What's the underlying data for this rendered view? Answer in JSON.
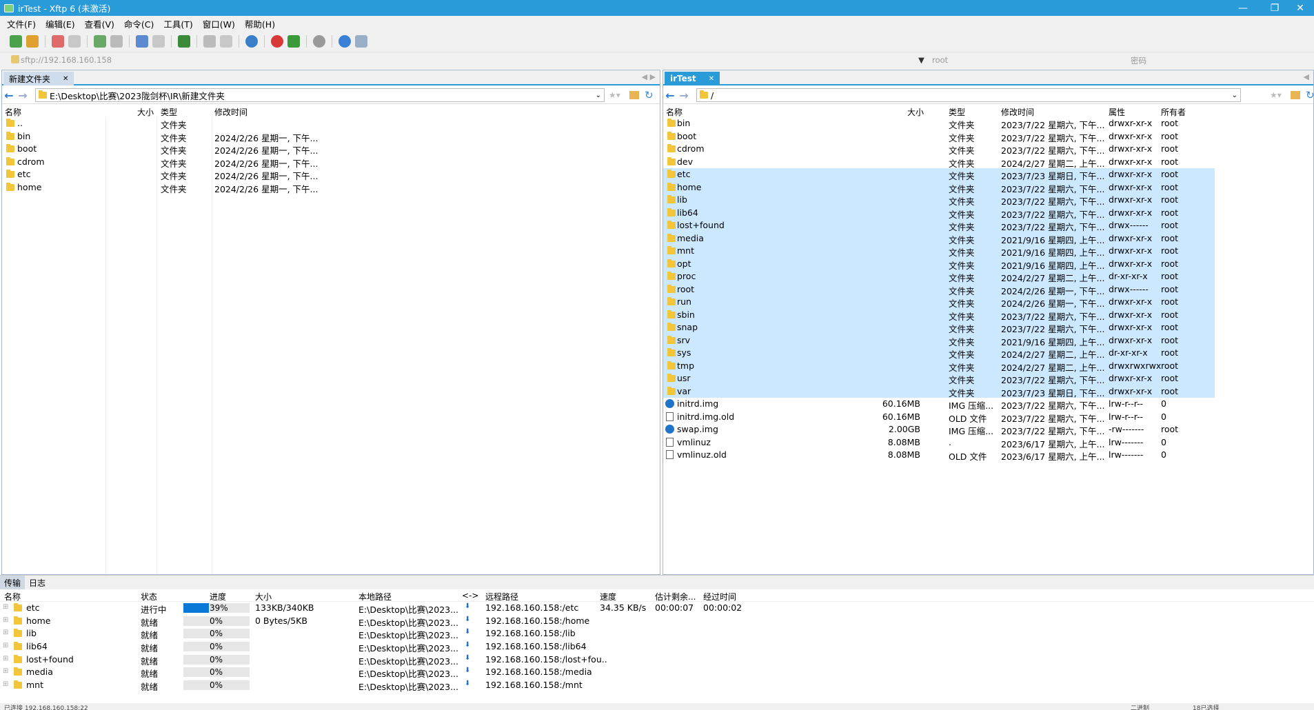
{
  "window": {
    "title": "irTest - Xftp 6 (未激活)"
  },
  "menu": [
    "文件(F)",
    "编辑(E)",
    "查看(V)",
    "命令(C)",
    "工具(T)",
    "窗口(W)",
    "帮助(H)"
  ],
  "address": {
    "url": "sftp://192.168.160.158",
    "user_placeholder": "root",
    "password_placeholder": "密码"
  },
  "left": {
    "tab": "新建文件夹",
    "path": "E:\\Desktop\\比赛\\2023陇剑杯\\IR\\新建文件夹",
    "headers": {
      "name": "名称",
      "size": "大小",
      "type": "类型",
      "mtime": "修改时间"
    },
    "files": [
      {
        "name": "..",
        "type": "文件夹",
        "mtime": ""
      },
      {
        "name": "bin",
        "type": "文件夹",
        "mtime": "2024/2/26 星期一, 下午..."
      },
      {
        "name": "boot",
        "type": "文件夹",
        "mtime": "2024/2/26 星期一, 下午..."
      },
      {
        "name": "cdrom",
        "type": "文件夹",
        "mtime": "2024/2/26 星期一, 下午..."
      },
      {
        "name": "etc",
        "type": "文件夹",
        "mtime": "2024/2/26 星期一, 下午..."
      },
      {
        "name": "home",
        "type": "文件夹",
        "mtime": "2024/2/26 星期一, 下午..."
      }
    ]
  },
  "right": {
    "tab": "irTest",
    "path": "/",
    "headers": {
      "name": "名称",
      "size": "大小",
      "type": "类型",
      "mtime": "修改时间",
      "attr": "属性",
      "owner": "所有者"
    },
    "files": [
      {
        "name": "bin",
        "size": "",
        "type": "文件夹",
        "mtime": "2023/7/22 星期六, 下午...",
        "attr": "drwxr-xr-x",
        "owner": "root",
        "sel": false,
        "icon": "folder"
      },
      {
        "name": "boot",
        "size": "",
        "type": "文件夹",
        "mtime": "2023/7/22 星期六, 下午...",
        "attr": "drwxr-xr-x",
        "owner": "root",
        "sel": false,
        "icon": "folder"
      },
      {
        "name": "cdrom",
        "size": "",
        "type": "文件夹",
        "mtime": "2023/7/22 星期六, 下午...",
        "attr": "drwxr-xr-x",
        "owner": "root",
        "sel": false,
        "icon": "folder"
      },
      {
        "name": "dev",
        "size": "",
        "type": "文件夹",
        "mtime": "2024/2/27 星期二, 上午...",
        "attr": "drwxr-xr-x",
        "owner": "root",
        "sel": false,
        "icon": "folder"
      },
      {
        "name": "etc",
        "size": "",
        "type": "文件夹",
        "mtime": "2023/7/23 星期日, 下午...",
        "attr": "drwxr-xr-x",
        "owner": "root",
        "sel": true,
        "icon": "folder"
      },
      {
        "name": "home",
        "size": "",
        "type": "文件夹",
        "mtime": "2023/7/22 星期六, 下午...",
        "attr": "drwxr-xr-x",
        "owner": "root",
        "sel": true,
        "icon": "folder"
      },
      {
        "name": "lib",
        "size": "",
        "type": "文件夹",
        "mtime": "2023/7/22 星期六, 下午...",
        "attr": "drwxr-xr-x",
        "owner": "root",
        "sel": true,
        "icon": "folder"
      },
      {
        "name": "lib64",
        "size": "",
        "type": "文件夹",
        "mtime": "2023/7/22 星期六, 下午...",
        "attr": "drwxr-xr-x",
        "owner": "root",
        "sel": true,
        "icon": "folder"
      },
      {
        "name": "lost+found",
        "size": "",
        "type": "文件夹",
        "mtime": "2023/7/22 星期六, 下午...",
        "attr": "drwx------",
        "owner": "root",
        "sel": true,
        "icon": "folder"
      },
      {
        "name": "media",
        "size": "",
        "type": "文件夹",
        "mtime": "2021/9/16 星期四, 上午...",
        "attr": "drwxr-xr-x",
        "owner": "root",
        "sel": true,
        "icon": "folder"
      },
      {
        "name": "mnt",
        "size": "",
        "type": "文件夹",
        "mtime": "2021/9/16 星期四, 上午...",
        "attr": "drwxr-xr-x",
        "owner": "root",
        "sel": true,
        "icon": "folder"
      },
      {
        "name": "opt",
        "size": "",
        "type": "文件夹",
        "mtime": "2021/9/16 星期四, 上午...",
        "attr": "drwxr-xr-x",
        "owner": "root",
        "sel": true,
        "icon": "folder"
      },
      {
        "name": "proc",
        "size": "",
        "type": "文件夹",
        "mtime": "2024/2/27 星期二, 上午...",
        "attr": "dr-xr-xr-x",
        "owner": "root",
        "sel": true,
        "icon": "folder"
      },
      {
        "name": "root",
        "size": "",
        "type": "文件夹",
        "mtime": "2024/2/26 星期一, 下午...",
        "attr": "drwx------",
        "owner": "root",
        "sel": true,
        "icon": "folder"
      },
      {
        "name": "run",
        "size": "",
        "type": "文件夹",
        "mtime": "2024/2/26 星期一, 下午...",
        "attr": "drwxr-xr-x",
        "owner": "root",
        "sel": true,
        "icon": "folder"
      },
      {
        "name": "sbin",
        "size": "",
        "type": "文件夹",
        "mtime": "2023/7/22 星期六, 下午...",
        "attr": "drwxr-xr-x",
        "owner": "root",
        "sel": true,
        "icon": "folder"
      },
      {
        "name": "snap",
        "size": "",
        "type": "文件夹",
        "mtime": "2023/7/22 星期六, 下午...",
        "attr": "drwxr-xr-x",
        "owner": "root",
        "sel": true,
        "icon": "folder"
      },
      {
        "name": "srv",
        "size": "",
        "type": "文件夹",
        "mtime": "2021/9/16 星期四, 上午...",
        "attr": "drwxr-xr-x",
        "owner": "root",
        "sel": true,
        "icon": "folder"
      },
      {
        "name": "sys",
        "size": "",
        "type": "文件夹",
        "mtime": "2024/2/27 星期二, 上午...",
        "attr": "dr-xr-xr-x",
        "owner": "root",
        "sel": true,
        "icon": "folder"
      },
      {
        "name": "tmp",
        "size": "",
        "type": "文件夹",
        "mtime": "2024/2/27 星期二, 上午...",
        "attr": "drwxrwxrwx",
        "owner": "root",
        "sel": true,
        "icon": "folder"
      },
      {
        "name": "usr",
        "size": "",
        "type": "文件夹",
        "mtime": "2023/7/22 星期六, 下午...",
        "attr": "drwxr-xr-x",
        "owner": "root",
        "sel": true,
        "icon": "folder"
      },
      {
        "name": "var",
        "size": "",
        "type": "文件夹",
        "mtime": "2023/7/23 星期日, 下午...",
        "attr": "drwxr-xr-x",
        "owner": "root",
        "sel": true,
        "icon": "folder"
      },
      {
        "name": "initrd.img",
        "size": "60.16MB",
        "type": "IMG 压缩...",
        "mtime": "2023/7/22 星期六, 下午...",
        "attr": "lrw-r--r--",
        "owner": "0",
        "sel": false,
        "icon": "img"
      },
      {
        "name": "initrd.img.old",
        "size": "60.16MB",
        "type": "OLD 文件",
        "mtime": "2023/7/22 星期六, 下午...",
        "attr": "lrw-r--r--",
        "owner": "0",
        "sel": false,
        "icon": "file"
      },
      {
        "name": "swap.img",
        "size": "2.00GB",
        "type": "IMG 压缩...",
        "mtime": "2023/7/22 星期六, 下午...",
        "attr": "-rw-------",
        "owner": "root",
        "sel": false,
        "icon": "img"
      },
      {
        "name": "vmlinuz",
        "size": "8.08MB",
        "type": ".",
        "mtime": "2023/6/17 星期六, 上午...",
        "attr": "lrw-------",
        "owner": "0",
        "sel": false,
        "icon": "file"
      },
      {
        "name": "vmlinuz.old",
        "size": "8.08MB",
        "type": "OLD 文件",
        "mtime": "2023/6/17 星期六, 上午...",
        "attr": "lrw-------",
        "owner": "0",
        "sel": false,
        "icon": "file"
      }
    ]
  },
  "transfer": {
    "tabs": [
      "传输",
      "日志"
    ],
    "headers": {
      "name": "名称",
      "status": "状态",
      "progress": "进度",
      "size": "大小",
      "local": "本地路径",
      "dir": "<->",
      "remote": "远程路径",
      "speed": "速度",
      "eta": "估计剩余...",
      "elapsed": "经过时间"
    },
    "rows": [
      {
        "name": "etc",
        "status": "进行中",
        "progress": 0.39,
        "progress_text": "39%",
        "size": "133KB/340KB",
        "local": "E:\\Desktop\\比赛\\2023...",
        "remote": "192.168.160.158:/etc",
        "speed": "34.35 KB/s",
        "eta": "00:00:07",
        "elapsed": "00:00:02"
      },
      {
        "name": "home",
        "status": "就绪",
        "progress": 0,
        "progress_text": "0%",
        "size": "0 Bytes/5KB",
        "local": "E:\\Desktop\\比赛\\2023...",
        "remote": "192.168.160.158:/home",
        "speed": "",
        "eta": "",
        "elapsed": ""
      },
      {
        "name": "lib",
        "status": "就绪",
        "progress": 0,
        "progress_text": "0%",
        "size": "",
        "local": "E:\\Desktop\\比赛\\2023...",
        "remote": "192.168.160.158:/lib",
        "speed": "",
        "eta": "",
        "elapsed": ""
      },
      {
        "name": "lib64",
        "status": "就绪",
        "progress": 0,
        "progress_text": "0%",
        "size": "",
        "local": "E:\\Desktop\\比赛\\2023...",
        "remote": "192.168.160.158:/lib64",
        "speed": "",
        "eta": "",
        "elapsed": ""
      },
      {
        "name": "lost+found",
        "status": "就绪",
        "progress": 0,
        "progress_text": "0%",
        "size": "",
        "local": "E:\\Desktop\\比赛\\2023...",
        "remote": "192.168.160.158:/lost+fou..",
        "speed": "",
        "eta": "",
        "elapsed": ""
      },
      {
        "name": "media",
        "status": "就绪",
        "progress": 0,
        "progress_text": "0%",
        "size": "",
        "local": "E:\\Desktop\\比赛\\2023...",
        "remote": "192.168.160.158:/media",
        "speed": "",
        "eta": "",
        "elapsed": ""
      },
      {
        "name": "mnt",
        "status": "就绪",
        "progress": 0,
        "progress_text": "0%",
        "size": "",
        "local": "E:\\Desktop\\比赛\\2023...",
        "remote": "192.168.160.158:/mnt",
        "speed": "",
        "eta": "",
        "elapsed": ""
      }
    ]
  },
  "status": {
    "left": "已连接 192.168.160.158:22",
    "right1": "二进制",
    "right2": "18已选择"
  },
  "colors": {
    "accent": "#2a9bd9",
    "selection": "#cce8ff",
    "progress": "#0a78d7"
  }
}
